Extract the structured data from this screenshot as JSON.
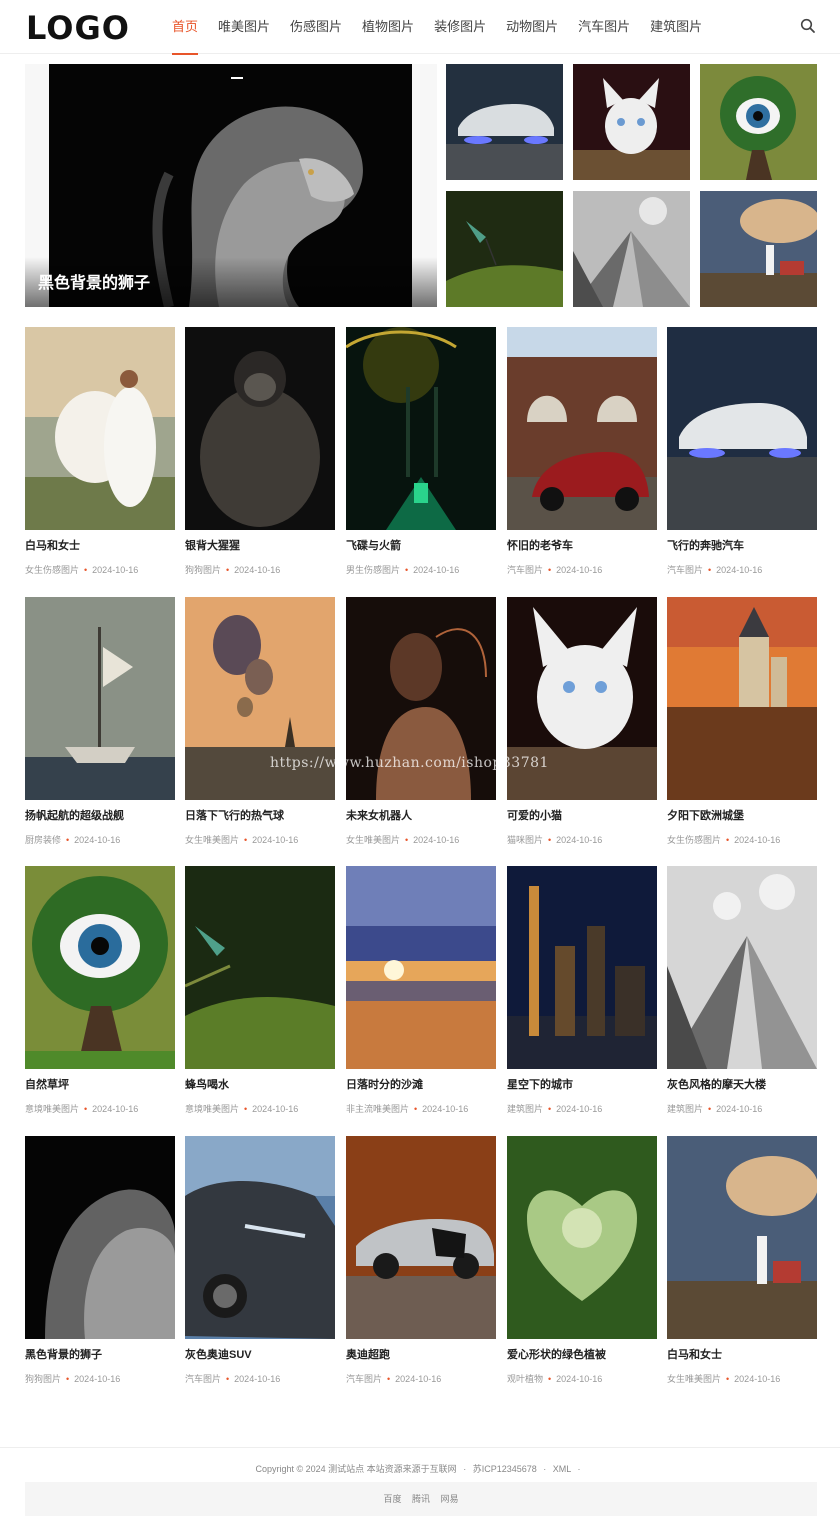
{
  "header": {
    "logo": "LOGO",
    "nav": [
      {
        "label": "首页",
        "active": true
      },
      {
        "label": "唯美图片"
      },
      {
        "label": "伤感图片"
      },
      {
        "label": "植物图片"
      },
      {
        "label": "装修图片"
      },
      {
        "label": "动物图片"
      },
      {
        "label": "汽车图片"
      },
      {
        "label": "建筑图片"
      }
    ],
    "search_icon": "search-icon"
  },
  "hero": {
    "caption": "黑色背景的狮子"
  },
  "cards": [
    {
      "title": "白马和女士",
      "category": "女生伤感图片",
      "date": "2024-10-16"
    },
    {
      "title": "银背大猩猩",
      "category": "狗狗图片",
      "date": "2024-10-16"
    },
    {
      "title": "飞碟与火箭",
      "category": "男生伤感图片",
      "date": "2024-10-16"
    },
    {
      "title": "怀旧的老爷车",
      "category": "汽车图片",
      "date": "2024-10-16"
    },
    {
      "title": "飞行的奔驰汽车",
      "category": "汽车图片",
      "date": "2024-10-16"
    },
    {
      "title": "扬帆起航的超级战舰",
      "category": "厨房装修",
      "date": "2024-10-16"
    },
    {
      "title": "日落下飞行的热气球",
      "category": "女生唯美图片",
      "date": "2024-10-16"
    },
    {
      "title": "未来女机器人",
      "category": "女生唯美图片",
      "date": "2024-10-16"
    },
    {
      "title": "可爱的小猫",
      "category": "猫咪图片",
      "date": "2024-10-16"
    },
    {
      "title": "夕阳下欧洲城堡",
      "category": "女生伤感图片",
      "date": "2024-10-16"
    },
    {
      "title": "自然草坪",
      "category": "意境唯美图片",
      "date": "2024-10-16"
    },
    {
      "title": "蜂鸟喝水",
      "category": "意境唯美图片",
      "date": "2024-10-16"
    },
    {
      "title": "日落时分的沙滩",
      "category": "非主流唯美图片",
      "date": "2024-10-16"
    },
    {
      "title": "星空下的城市",
      "category": "建筑图片",
      "date": "2024-10-16"
    },
    {
      "title": "灰色风格的摩天大楼",
      "category": "建筑图片",
      "date": "2024-10-16"
    },
    {
      "title": "黑色背景的狮子",
      "category": "狗狗图片",
      "date": "2024-10-16"
    },
    {
      "title": "灰色奥迪SUV",
      "category": "汽车图片",
      "date": "2024-10-16"
    },
    {
      "title": "奥迪超跑",
      "category": "汽车图片",
      "date": "2024-10-16"
    },
    {
      "title": "爱心形状的绿色植被",
      "category": "观叶植物",
      "date": "2024-10-16"
    },
    {
      "title": "白马和女士",
      "category": "女生唯美图片",
      "date": "2024-10-16"
    }
  ],
  "watermark": "https://www.huzhan.com/ishop33781",
  "footer": {
    "copyright": "Copyright © 2024 测试站点 本站资源来源于互联网",
    "icp": "苏ICP12345678",
    "xml": "XML",
    "links": [
      "百度",
      "腾讯",
      "网易"
    ]
  },
  "colors": {
    "accent": "#e8552a",
    "text": "#222222",
    "meta": "#999999"
  }
}
